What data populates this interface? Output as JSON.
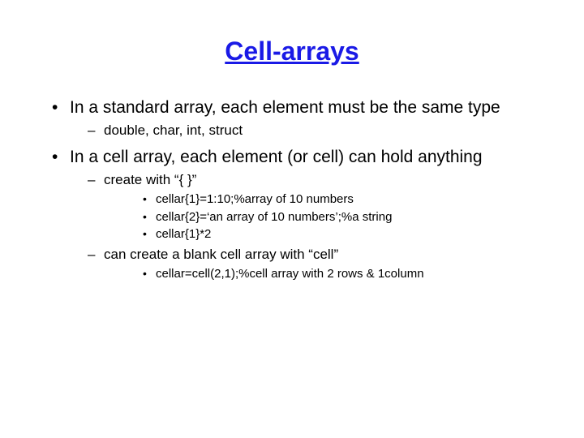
{
  "title": "Cell-arrays",
  "bullets": [
    {
      "text": "In a standard array, each element must be the same type",
      "sub": [
        {
          "text": "double, char, int, struct"
        }
      ]
    },
    {
      "text": "In a cell array, each element (or cell) can hold anything",
      "sub": [
        {
          "text": "create with “{ }”",
          "sub": [
            {
              "text": "cellar{1}=1:10;%array of 10 numbers"
            },
            {
              "text": "cellar{2}=‘an array of 10 numbers’;%a string"
            },
            {
              "text": "cellar{1}*2"
            }
          ]
        },
        {
          "text": "can create a blank cell array with “cell”",
          "sub": [
            {
              "text": "cellar=cell(2,1);%cell array with 2 rows & 1column"
            }
          ]
        }
      ]
    }
  ]
}
